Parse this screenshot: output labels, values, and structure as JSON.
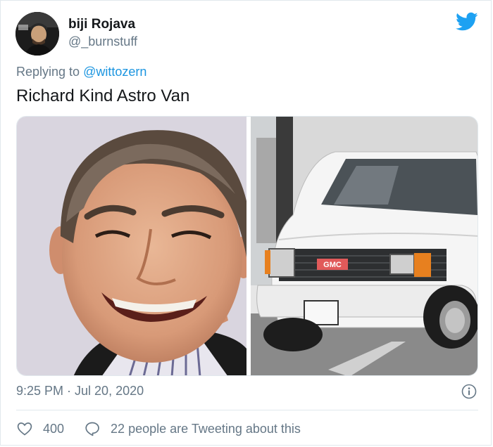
{
  "user": {
    "display_name": "biji Rojava",
    "handle": "@_burnstuff"
  },
  "reply": {
    "prefix": "Replying to",
    "mention": "@wittozern"
  },
  "tweet": {
    "text": "Richard Kind Astro Van"
  },
  "media": {
    "left_image": "portrait of smiling man",
    "right_image": "white GMC van front",
    "van_grille_text": "GMC"
  },
  "meta": {
    "timestamp": "9:25 PM · Jul 20, 2020"
  },
  "actions": {
    "likes": "400",
    "talking": "22 people are Tweeting about this"
  },
  "colors": {
    "brand": "#1da1f2",
    "link": "#1b95e0",
    "muted": "#657786"
  },
  "icons": {
    "logo": "twitter-bird-icon",
    "info": "info-icon",
    "like": "heart-icon",
    "reply": "speech-bubble-icon"
  }
}
